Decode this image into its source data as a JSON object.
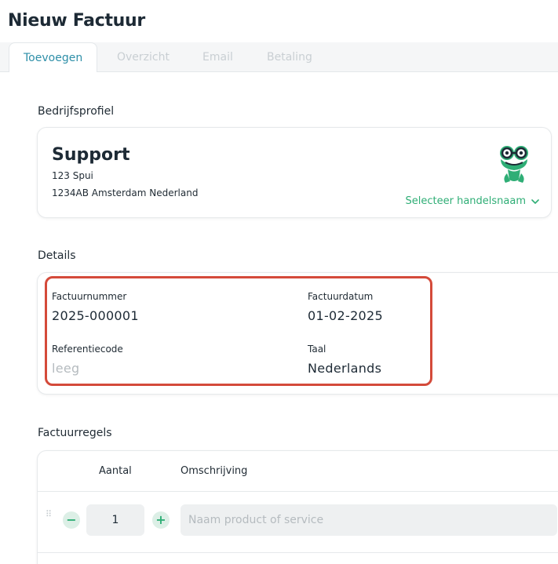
{
  "page": {
    "title": "Nieuw Factuur"
  },
  "tabs": [
    {
      "label": "Toevoegen",
      "active": true
    },
    {
      "label": "Overzicht",
      "active": false
    },
    {
      "label": "Email",
      "active": false
    },
    {
      "label": "Betaling",
      "active": false
    }
  ],
  "company_section": {
    "label": "Bedrijfsprofiel",
    "name": "Support",
    "address_line1": "123 Spui",
    "address_line2": "1234AB Amsterdam Nederland",
    "select_trade_name": "Selecteer handelsnaam",
    "mascot_icon": "frog-mascot-icon"
  },
  "details_section": {
    "label": "Details",
    "invoice_number_label": "Factuurnummer",
    "invoice_number_value": "2025-000001",
    "invoice_date_label": "Factuurdatum",
    "invoice_date_value": "01-02-2025",
    "reference_label": "Referentiecode",
    "reference_placeholder": "leeg",
    "language_label": "Taal",
    "language_value": "Nederlands"
  },
  "lines_section": {
    "label": "Factuurregels",
    "col_quantity": "Aantal",
    "col_description": "Omschrijving",
    "row": {
      "quantity": "1",
      "description_placeholder": "Naam product of service",
      "minus_label": "−",
      "plus_label": "+"
    }
  },
  "colors": {
    "accent_tab": "#2e8fa8",
    "accent_green": "#2fae76",
    "highlight_red": "#d44a3a"
  }
}
